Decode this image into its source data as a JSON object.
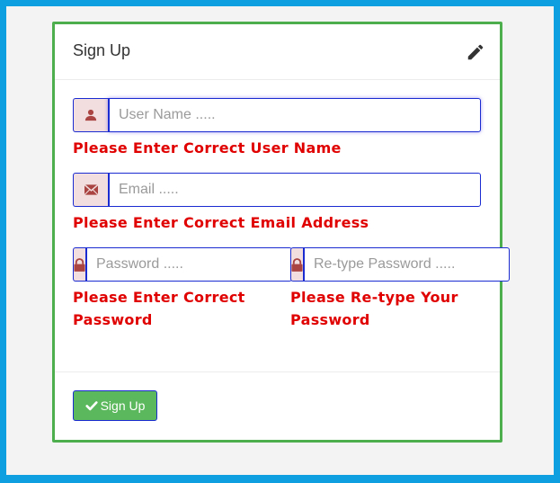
{
  "panel": {
    "title": "Sign Up"
  },
  "form": {
    "username": {
      "placeholder": "User Name .....",
      "value": "",
      "error": "Please Enter Correct User Name"
    },
    "email": {
      "placeholder": "Email .....",
      "value": "",
      "error": "Please Enter Correct Email Address"
    },
    "password": {
      "placeholder": "Password .....",
      "value": "",
      "error_line1": "Please Enter Correct",
      "error_line2": "Password"
    },
    "retype_password": {
      "placeholder": "Re-type Password .....",
      "value": "",
      "error_line1": "Please Re-type Your",
      "error_line2": "Password"
    }
  },
  "footer": {
    "submit_label": "Sign Up"
  },
  "colors": {
    "border_panel": "#4cae4c",
    "addon_bg": "#f2dede",
    "error_text": "#e00000",
    "button_bg": "#5cb85c",
    "outer_bg": "#0d9fe0"
  },
  "icons": {
    "header": "pencil-icon",
    "username": "user-icon",
    "email": "envelope-icon",
    "password": "lock-icon",
    "retype_password": "lock-icon",
    "submit": "check-icon"
  }
}
